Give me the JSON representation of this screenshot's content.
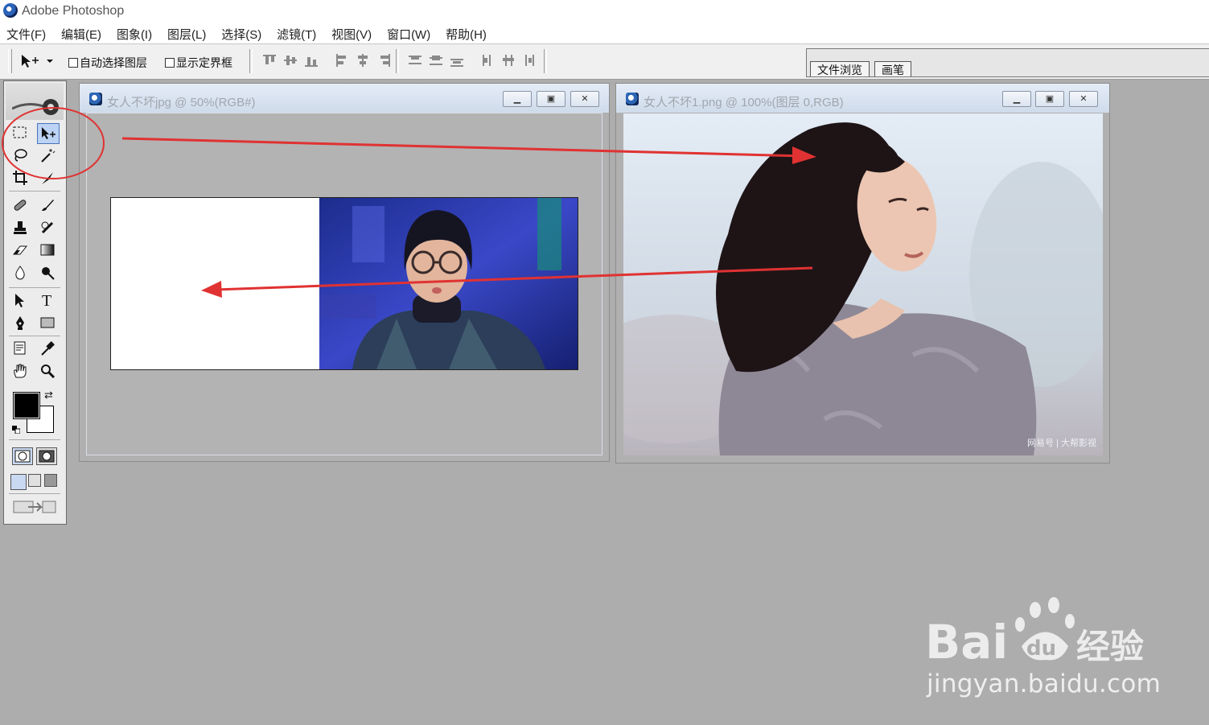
{
  "app": {
    "title": "Adobe Photoshop"
  },
  "menu": [
    {
      "label": "文件(F)"
    },
    {
      "label": "编辑(E)"
    },
    {
      "label": "图象(I)"
    },
    {
      "label": "图层(L)"
    },
    {
      "label": "选择(S)"
    },
    {
      "label": "滤镜(T)"
    },
    {
      "label": "视图(V)"
    },
    {
      "label": "窗口(W)"
    },
    {
      "label": "帮助(H)"
    }
  ],
  "options_bar": {
    "auto_select_label": "自动选择图层",
    "auto_select_checked": false,
    "show_bounds_label": "显示定界框",
    "show_bounds_checked": false
  },
  "palette_well": {
    "tabs": [
      "文件浏览",
      "画笔"
    ]
  },
  "documents": [
    {
      "title": "女人不坏jpg @ 50%(RGB#)"
    },
    {
      "title": "女人不坏1.png @ 100%(图层 0,RGB)"
    }
  ],
  "photo_credit": "网易号 | 大帮影视",
  "colors": {
    "annotation": "#e03232",
    "workspace": "#adadad",
    "foreground": "#000000",
    "background": "#ffffff"
  },
  "watermark": {
    "brand": "Bai du 经验",
    "url": "jingyan.baidu.com"
  }
}
